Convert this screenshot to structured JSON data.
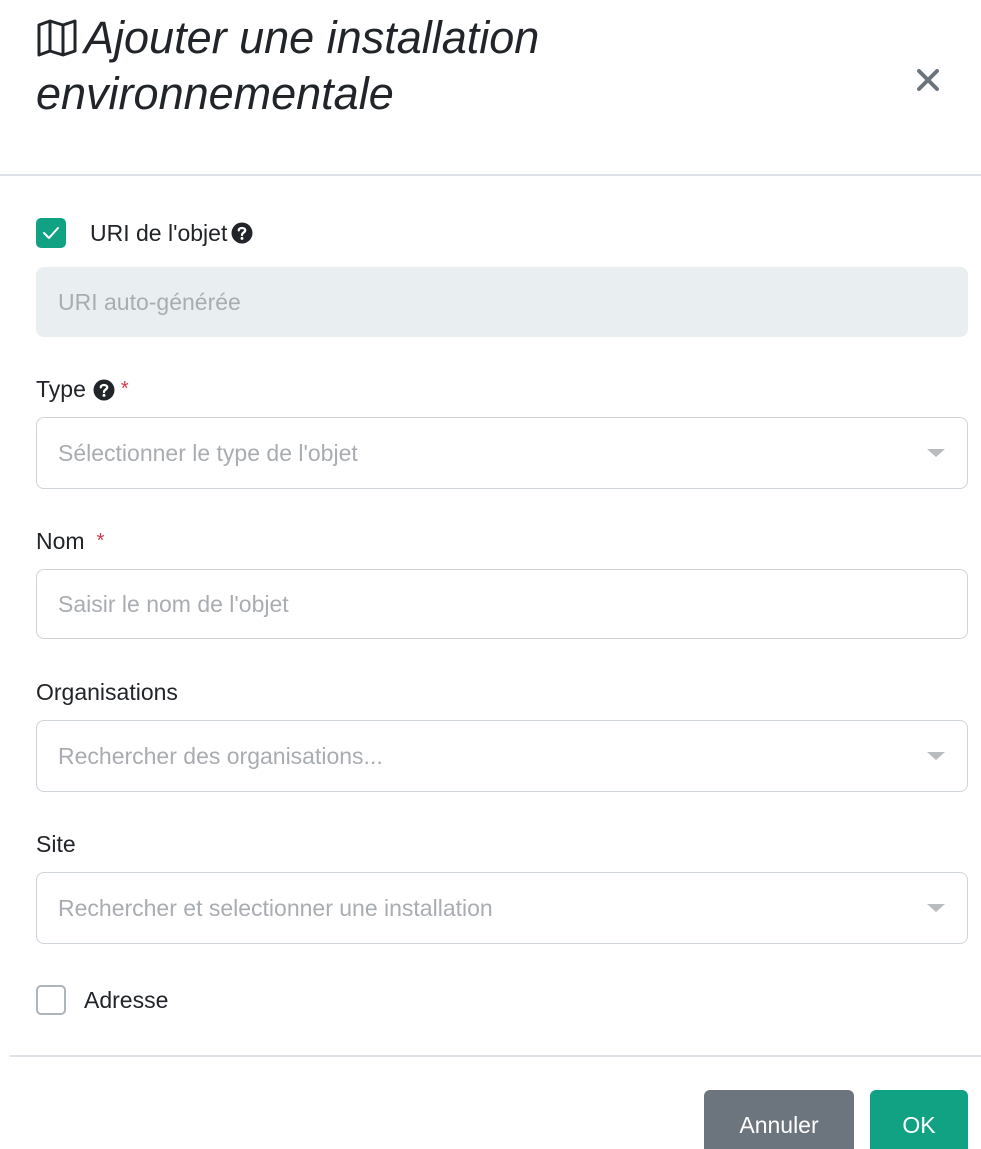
{
  "dialog": {
    "title": "Ajouter une installation environnementale",
    "title_icon": "map-icon",
    "close_icon": "close-icon",
    "close_label": "×"
  },
  "uri": {
    "checkbox_checked": true,
    "label": "URI de l'objet",
    "help_icon": "question-circle-icon",
    "placeholder": "URI auto-générée",
    "value": ""
  },
  "type": {
    "label": "Type",
    "help_icon": "question-circle-icon",
    "required": "*",
    "placeholder": "Sélectionner le type de l'objet"
  },
  "name": {
    "label": "Nom",
    "required": "*",
    "placeholder": "Saisir le nom de l'objet",
    "value": ""
  },
  "organisations": {
    "label": "Organisations",
    "placeholder": "Rechercher des organisations..."
  },
  "site": {
    "label": "Site",
    "placeholder": "Rechercher et selectionner une installation"
  },
  "address": {
    "checkbox_checked": false,
    "label": "Adresse"
  },
  "footer": {
    "cancel_label": "Annuler",
    "ok_label": "OK"
  },
  "colors": {
    "accent": "#11a284",
    "cancel": "#6c757d",
    "required": "#dc3545"
  }
}
